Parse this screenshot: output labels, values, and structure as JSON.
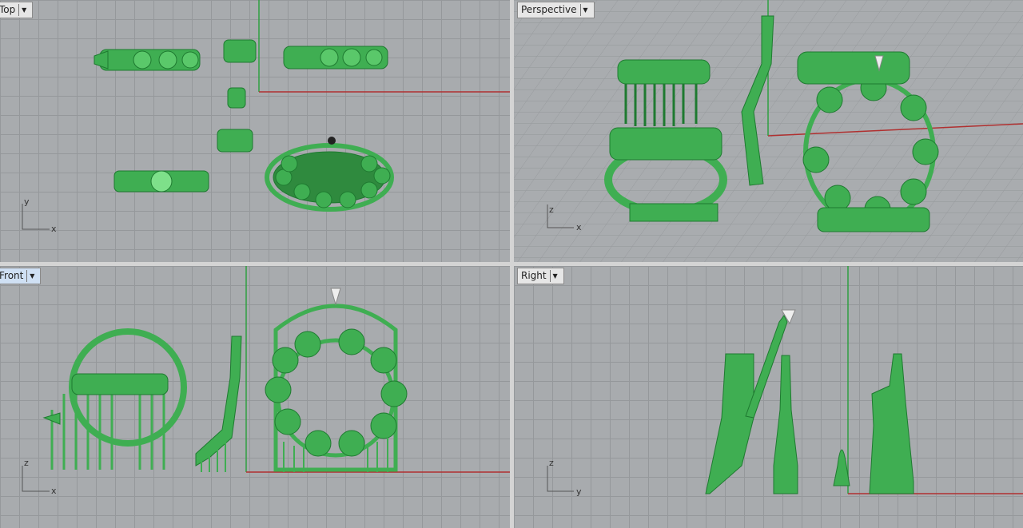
{
  "viewports": {
    "top": {
      "label": "Top",
      "active": false,
      "axes": [
        "y",
        "x"
      ]
    },
    "perspective": {
      "label": "Perspective",
      "active": false,
      "axes": [
        "z",
        "x"
      ]
    },
    "front": {
      "label": "Front",
      "active": true,
      "axes": [
        "z",
        "x"
      ]
    },
    "right": {
      "label": "Right",
      "active": false,
      "axes": [
        "z",
        "y"
      ]
    }
  },
  "colors": {
    "model": "#3fae52",
    "model_dark": "#1e7a30",
    "model_light": "#7ee08a",
    "grid_bg": "#a8abae",
    "x_axis": "#b03030",
    "y_axis": "#2fa040"
  },
  "tab_menu_icon": "chevron-down-icon"
}
